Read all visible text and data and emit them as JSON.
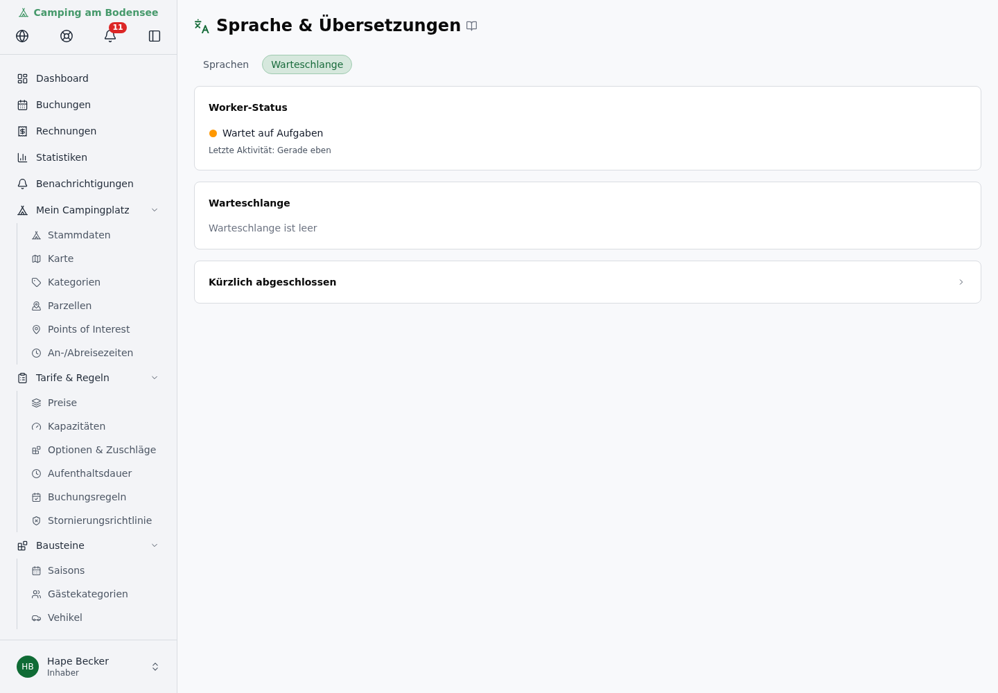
{
  "sidebar": {
    "brand": "Camping am Bodensee",
    "notification_count": "11",
    "nav": [
      {
        "label": "Dashboard",
        "selected": false
      },
      {
        "label": "Buchungen",
        "selected": false
      },
      {
        "label": "Rechnungen",
        "selected": false
      },
      {
        "label": "Statistiken",
        "selected": false
      },
      {
        "label": "Benachrichtigungen",
        "selected": false
      },
      {
        "label": "Mein Campingplatz",
        "selected": false,
        "expanded": true,
        "children": [
          {
            "label": "Stammdaten",
            "selected": false
          },
          {
            "label": "Karte",
            "selected": false
          },
          {
            "label": "Kategorien",
            "selected": false
          },
          {
            "label": "Parzellen",
            "selected": false
          },
          {
            "label": "Points of Interest",
            "selected": false
          },
          {
            "label": "An-/Abreisezeiten",
            "selected": false
          }
        ]
      },
      {
        "label": "Tarife & Regeln",
        "selected": false,
        "expanded": true,
        "children": [
          {
            "label": "Preise",
            "selected": false
          },
          {
            "label": "Kapazitäten",
            "selected": false
          },
          {
            "label": "Optionen & Zuschläge",
            "selected": false
          },
          {
            "label": "Aufenthaltsdauer",
            "selected": false
          },
          {
            "label": "Buchungsregeln",
            "selected": false
          },
          {
            "label": "Stornierungsrichtlinie",
            "selected": false
          }
        ]
      },
      {
        "label": "Bausteine",
        "selected": false,
        "expanded": true,
        "children": [
          {
            "label": "Saisons",
            "selected": false
          },
          {
            "label": "Gästekategorien",
            "selected": false
          },
          {
            "label": "Vehikel",
            "selected": false
          }
        ]
      }
    ],
    "user": {
      "initials": "HB",
      "name": "Hape Becker",
      "role": "Inhaber"
    }
  },
  "page": {
    "title": "Sprache & Übersetzungen",
    "tabs": [
      {
        "label": "Sprachen",
        "selected": false
      },
      {
        "label": "Warteschlange",
        "selected": true
      }
    ]
  },
  "worker_status": {
    "title": "Worker-Status",
    "busy": false,
    "status": "Wartet auf Aufgaben",
    "last_activity": "Letzte Aktivität: Gerade eben"
  },
  "queue": {
    "title": "Warteschlange",
    "message": "Warteschlange ist leer"
  },
  "recently_completed": {
    "title": "Kürzlich abgeschlossen",
    "expanded": false
  }
}
